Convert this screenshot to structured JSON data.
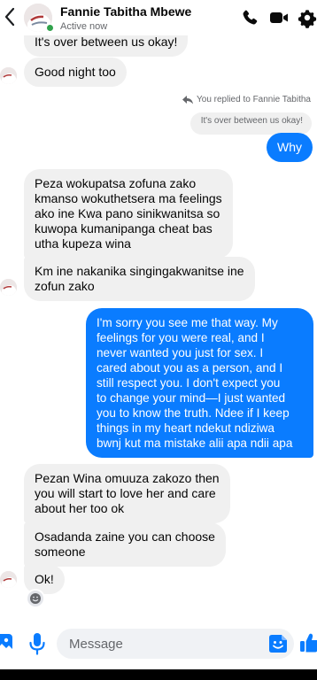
{
  "header": {
    "contact_name": "Fannie Tabitha Mbewe",
    "status": "Active now"
  },
  "messages": {
    "m1": "It's over between us okay!",
    "m2": "Good night too",
    "reply_label": "You replied to Fannie Tabitha",
    "reply_quote": "It's over between us okay!",
    "m3": "Why",
    "m4": "Peza wokupatsa zofuna zako\nkmanso wokuthetsera ma feelings\nako ine Kwa pano sinikwanitsa so\nkuwopa kumanipanga cheat bas\nutha kupeza wina",
    "m5": "Km ine nakanika singingakwanitse ine\nzofun zako",
    "m6": "I'm sorry you see me that way. My\nfeelings for you were real, and I\nnever wanted you just for sex. I\ncared about you as a person, and I\nstill respect you. I don't expect you\nto change your mind—I just wanted\nyou to know the truth. Ndee if I keep\nthings in my heart ndekut ndiziwa\nbwnj kut ma mistake alii apa ndii apa",
    "m7": "Pezan Wina omuuza zakozo then\nyou will start to love her and care\nabout her too ok",
    "m8": "Osadanda zaine   you can choose\nsomeone",
    "m9": "Ok!"
  },
  "composer": {
    "placeholder": "Message"
  },
  "colors": {
    "accent": "#0a7cff",
    "incoming_bubble": "#f0f0f0",
    "online": "#31a24c"
  },
  "icons": [
    "back-arrow-icon",
    "phone-icon",
    "video-camera-icon",
    "gear-icon",
    "reply-arrow-icon",
    "emoji-reaction-icon",
    "image-icon",
    "microphone-icon",
    "sticker-icon",
    "thumbs-up-icon"
  ]
}
